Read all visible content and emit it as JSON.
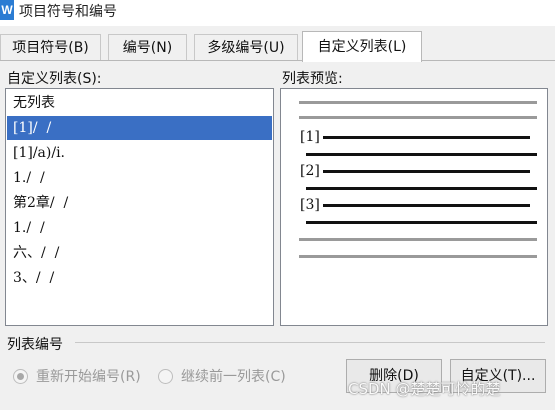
{
  "window": {
    "icon_letter": "W",
    "title": "项目符号和编号"
  },
  "tabs": [
    {
      "label": "项目符号(B)",
      "active": false
    },
    {
      "label": "编号(N)",
      "active": false
    },
    {
      "label": "多级编号(U)",
      "active": false
    },
    {
      "label": "自定义列表(L)",
      "active": true
    }
  ],
  "custom_list": {
    "label": "自定义列表(S):",
    "items": [
      "无列表",
      "[1]/  /",
      "[1]/a)/i.",
      "1./  /",
      "第2章/  /",
      "1./  /",
      "六、/  /",
      "3、/  /"
    ],
    "selected_index": 1
  },
  "preview": {
    "label": "列表预览:",
    "markers": [
      "[1]",
      "[2]",
      "[3]"
    ]
  },
  "numbering": {
    "group_label": "列表编号",
    "restart_label": "重新开始编号(R)",
    "continue_label": "继续前一列表(C)",
    "restart_checked": true
  },
  "buttons": {
    "delete": "删除(D)",
    "customize": "自定义(T)..."
  },
  "watermark": "CSDN @楚楚可怜的楚",
  "colors": {
    "selection": "#3a6fc4",
    "app_icon": "#2b7cd3"
  }
}
